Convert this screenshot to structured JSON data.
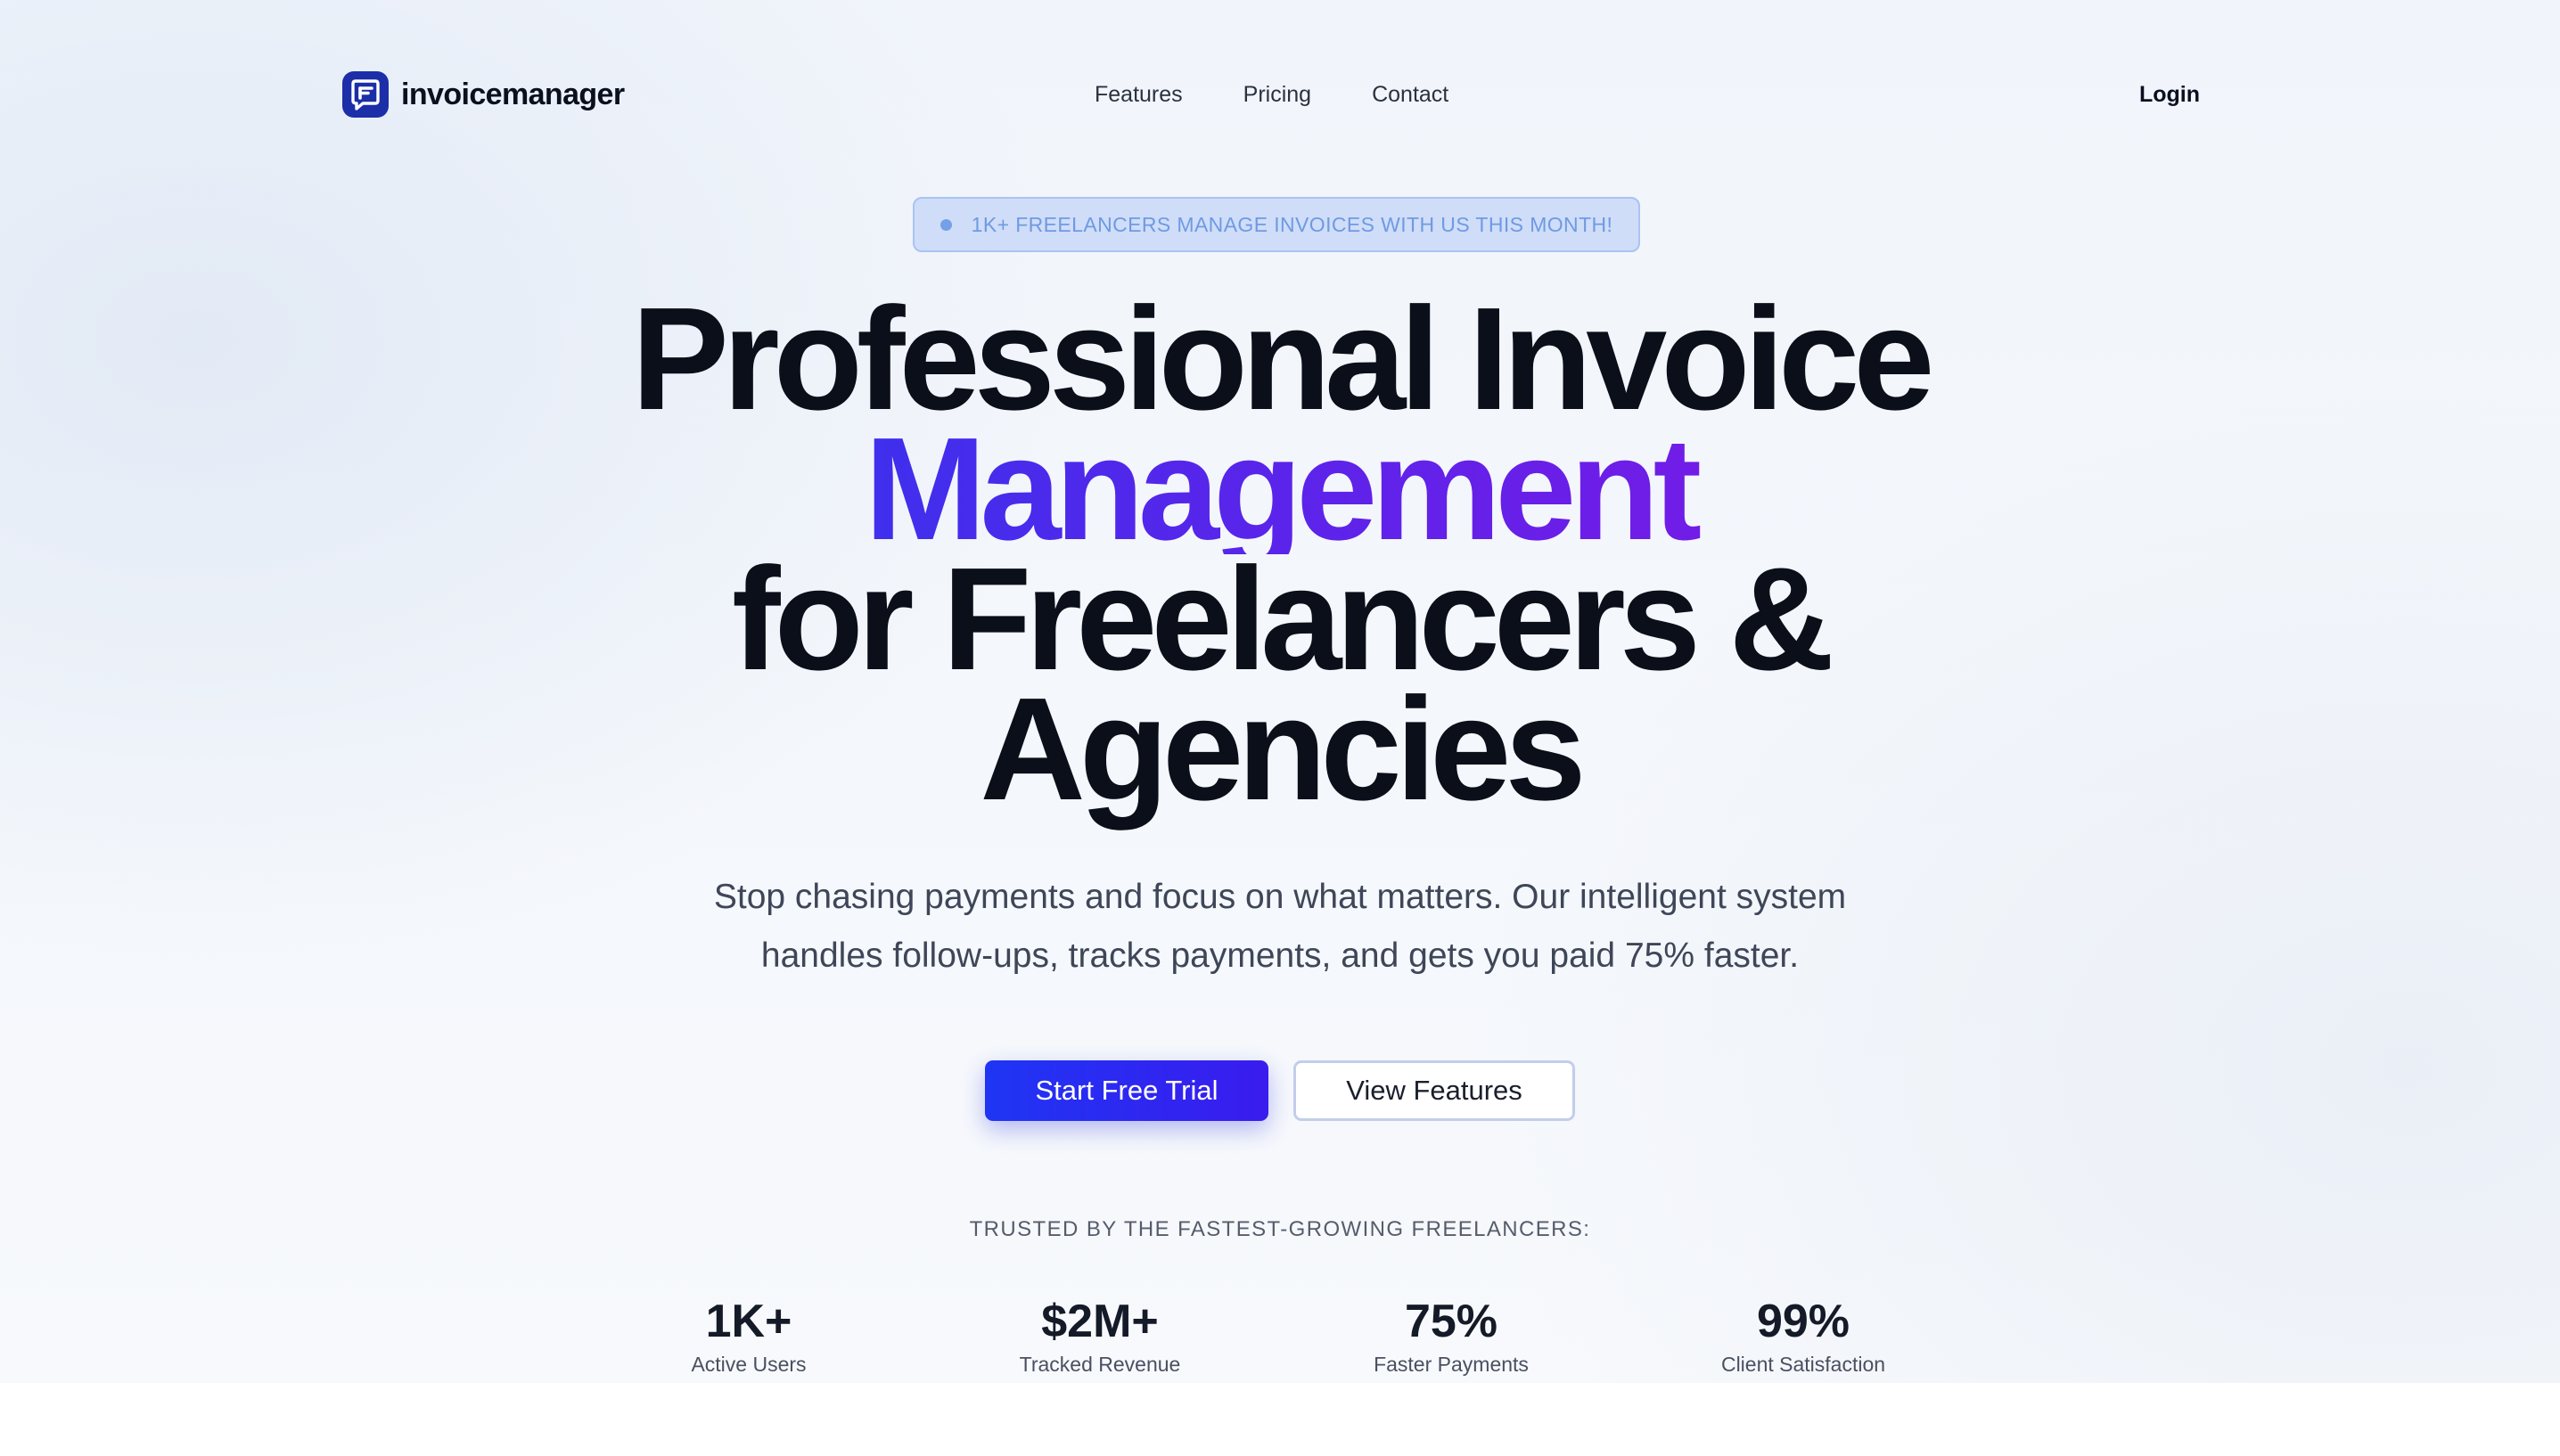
{
  "nav": {
    "brand": "invoicemanager",
    "links": [
      "Features",
      "Pricing",
      "Contact"
    ],
    "login": "Login"
  },
  "badge": {
    "text": "1K+ FREELANCERS MANAGE INVOICES WITH US THIS MONTH!"
  },
  "hero": {
    "title_line1": "Professional Invoice",
    "title_highlight": "Management",
    "title_line3": "for Freelancers &",
    "title_line4": "Agencies",
    "subtitle_line1": "Stop chasing payments and focus on what matters. Our intelligent system",
    "subtitle_line2": "handles follow-ups, tracks payments, and gets you paid 75% faster."
  },
  "cta": {
    "primary": "Start Free Trial",
    "secondary": "View Features"
  },
  "trust": {
    "heading": "TRUSTED BY THE FASTEST-GROWING FREELANCERS:",
    "stats": [
      {
        "value": "1K+",
        "label": "Active Users"
      },
      {
        "value": "$2M+",
        "label": "Tracked Revenue"
      },
      {
        "value": "75%",
        "label": "Faster Payments"
      },
      {
        "value": "99%",
        "label": "Client Satisfaction"
      }
    ]
  },
  "colors": {
    "brand": "#1c2fa8",
    "primary_button": "#1f35f4",
    "gradient_start": "#1e3cf0",
    "gradient_end": "#8a14e3",
    "badge_bg": "#cfddf8",
    "badge_text": "#6f9ae3"
  },
  "icons": {
    "logo": "invoice-chat-logo-icon",
    "badge": "dot-icon"
  }
}
